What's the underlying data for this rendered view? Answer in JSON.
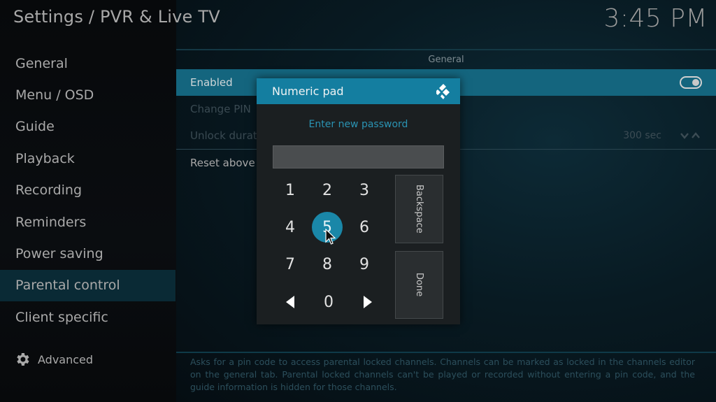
{
  "header": {
    "title": "Settings / PVR & Live TV",
    "clock": "3:45 PM"
  },
  "sidebar": {
    "items": [
      {
        "label": "General"
      },
      {
        "label": "Menu / OSD"
      },
      {
        "label": "Guide"
      },
      {
        "label": "Playback"
      },
      {
        "label": "Recording"
      },
      {
        "label": "Reminders"
      },
      {
        "label": "Power saving"
      },
      {
        "label": "Parental control",
        "active": true
      },
      {
        "label": "Client specific"
      }
    ],
    "advanced_label": "Advanced",
    "advanced_icon": "gear-icon"
  },
  "main": {
    "group_title": "General",
    "rows": {
      "enabled": {
        "label": "Enabled",
        "state": "on"
      },
      "change_pin": {
        "label": "Change PIN"
      },
      "unlock_duration": {
        "label": "Unlock duration",
        "value": "300 sec"
      },
      "reset": {
        "label": "Reset above settings to default"
      }
    },
    "description": "Asks for a pin code to access parental locked channels. Channels can be marked as locked in the channels editor on the general tab. Parental locked channels can't be played or recorded without entering a pin code, and the guide information is hidden for those channels."
  },
  "dialog": {
    "title": "Numeric pad",
    "logo_icon": "kodi-logo-icon",
    "prompt": "Enter new password",
    "password_value": "",
    "keys": {
      "k1": "1",
      "k2": "2",
      "k3": "3",
      "k4": "4",
      "k5": "5",
      "k6": "6",
      "k7": "7",
      "k8": "8",
      "k9": "9",
      "k0": "0"
    },
    "focused_key": "5",
    "backspace_label": "Backspace",
    "done_label": "Done"
  },
  "colors": {
    "accent": "#147ea0",
    "focused_row": "#14657e",
    "prompt_text": "#2a93b3",
    "active_sidebar": "#0a2a35"
  }
}
